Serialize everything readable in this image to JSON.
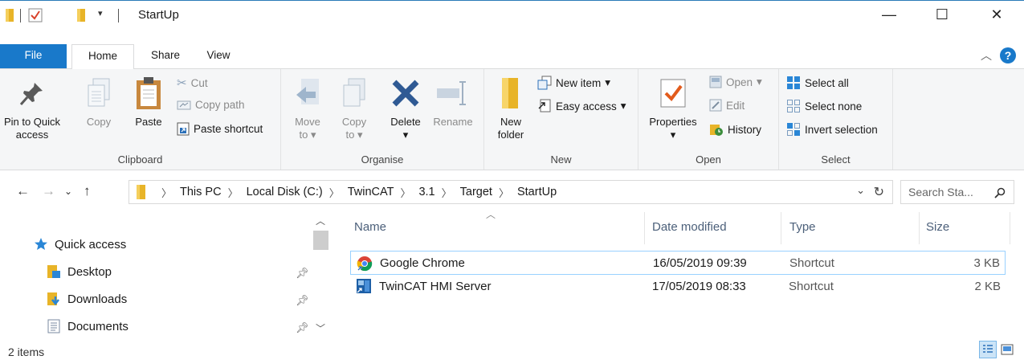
{
  "window": {
    "title": "StartUp",
    "minimize_glyph": "—",
    "maximize_glyph": "☐",
    "close_glyph": "✕"
  },
  "ribbon_tabs": {
    "file": "File",
    "home": "Home",
    "share": "Share",
    "view": "View"
  },
  "ribbon": {
    "clipboard": {
      "label": "Clipboard",
      "pin_line1": "Pin to Quick",
      "pin_line2": "access",
      "copy": "Copy",
      "paste": "Paste",
      "cut": "Cut",
      "copy_path": "Copy path",
      "paste_shortcut": "Paste shortcut"
    },
    "organise": {
      "label": "Organise",
      "move_line1": "Move",
      "move_line2": "to",
      "copy_line1": "Copy",
      "copy_line2": "to",
      "delete": "Delete",
      "rename": "Rename"
    },
    "new": {
      "label": "New",
      "folder_line1": "New",
      "folder_line2": "folder",
      "new_item": "New item",
      "easy_access": "Easy access"
    },
    "open": {
      "label": "Open",
      "properties": "Properties",
      "open": "Open",
      "edit": "Edit",
      "history": "History"
    },
    "select": {
      "label": "Select",
      "select_all": "Select all",
      "select_none": "Select none",
      "invert_selection": "Invert selection"
    }
  },
  "address": {
    "crumbs": [
      "This PC",
      "Local Disk (C:)",
      "TwinCAT",
      "3.1",
      "Target",
      "StartUp"
    ],
    "search_placeholder": "Search Sta..."
  },
  "navpane": {
    "quick_access": "Quick access",
    "items": [
      {
        "label": "Desktop"
      },
      {
        "label": "Downloads"
      },
      {
        "label": "Documents"
      }
    ]
  },
  "filelist": {
    "columns": {
      "name": "Name",
      "date": "Date modified",
      "type": "Type",
      "size": "Size"
    },
    "rows": [
      {
        "name": "Google Chrome",
        "date": "16/05/2019 09:39",
        "type": "Shortcut",
        "size": "3 KB"
      },
      {
        "name": "TwinCAT HMI Server",
        "date": "17/05/2019 08:33",
        "type": "Shortcut",
        "size": "2 KB"
      }
    ]
  },
  "status": {
    "count": "2 items"
  },
  "colors": {
    "accent": "#1979ca",
    "folder": "#e8b428",
    "selection_border": "#99d1ff",
    "header_text": "#4c607a"
  }
}
